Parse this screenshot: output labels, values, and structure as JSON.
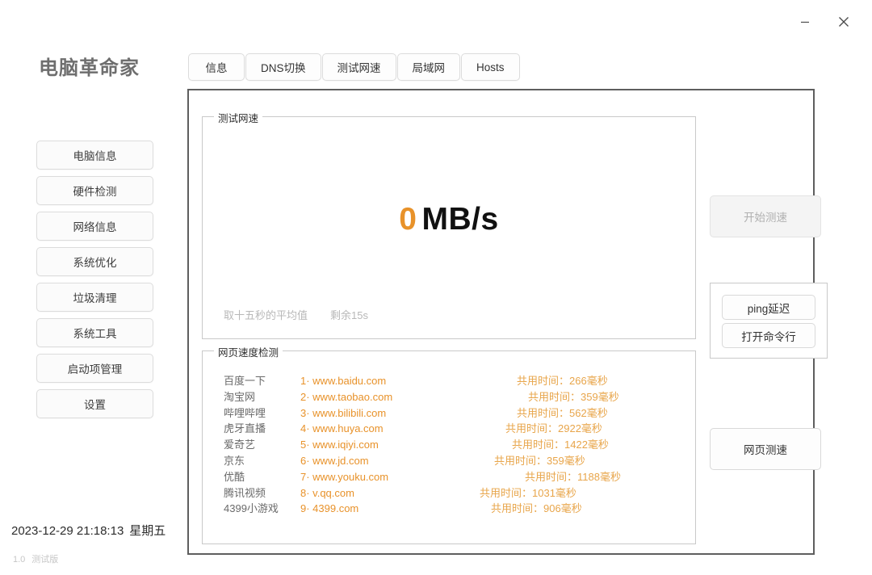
{
  "window": {
    "title": "电脑革命家",
    "controls": [
      {
        "name": "minimize",
        "icon": "minimize-icon",
        "label": "−"
      },
      {
        "name": "close",
        "icon": "close-icon",
        "label": "×"
      }
    ]
  },
  "tabs": [
    {
      "label": "信息"
    },
    {
      "label": "DNS切换"
    },
    {
      "label": "测试网速"
    },
    {
      "label": "局域网"
    },
    {
      "label": "Hosts"
    }
  ],
  "sidebar": {
    "items": [
      {
        "label": "电脑信息"
      },
      {
        "label": "硬件检测"
      },
      {
        "label": "网络信息"
      },
      {
        "label": "系统优化"
      },
      {
        "label": "垃圾清理"
      },
      {
        "label": "系统工具"
      },
      {
        "label": "启动项管理"
      },
      {
        "label": "设置"
      }
    ]
  },
  "speed_group": {
    "title": "测试网速",
    "value": "0",
    "unit": "MB/s",
    "note_average": "取十五秒的平均值",
    "note_remaining": "剩余15s"
  },
  "actions": {
    "start_label": "开始测速",
    "start_disabled": true,
    "ping_label": "ping延迟",
    "cmd_label": "打开命令行",
    "webtest_label": "网页测速"
  },
  "web_group": {
    "title": "网页速度检测",
    "rows": [
      {
        "name": "百度一下",
        "url": "1· www.baidu.com",
        "time": "共用时间：266毫秒",
        "indent": 118
      },
      {
        "name": "淘宝网",
        "url": "2· www.taobao.com",
        "time": "共用时间：359毫秒",
        "indent": 132
      },
      {
        "name": "哔哩哔哩",
        "url": "3· www.bilibili.com",
        "time": "共用时间：562毫秒",
        "indent": 118
      },
      {
        "name": "虎牙直播",
        "url": "4· www.huya.com",
        "time": "共用时间：2922毫秒",
        "indent": 104
      },
      {
        "name": "爱奇艺",
        "url": "5· www.iqiyi.com",
        "time": "共用时间：1422毫秒",
        "indent": 112
      },
      {
        "name": "京东",
        "url": "6· www.jd.com",
        "time": "共用时间：359毫秒",
        "indent": 90
      },
      {
        "name": "优酷",
        "url": "7· www.youku.com",
        "time": "共用时间：1188毫秒",
        "indent": 128
      },
      {
        "name": "腾讯视频",
        "url": "8· v.qq.com",
        "time": "共用时间：1031毫秒",
        "indent": 72
      },
      {
        "name": "4399小游戏",
        "url": "9· 4399.com",
        "time": "共用时间：906毫秒",
        "indent": 86
      }
    ]
  },
  "statusbar": {
    "datetime": "2023-12-29 21:18:13",
    "weekday": "星期五",
    "version": "1.0",
    "build": "测试版"
  },
  "colors": {
    "accent_orange": "#e8922a",
    "time_orange": "#e8a54a",
    "panel_border": "#5e5e5e",
    "group_border": "#c9c9c9"
  }
}
